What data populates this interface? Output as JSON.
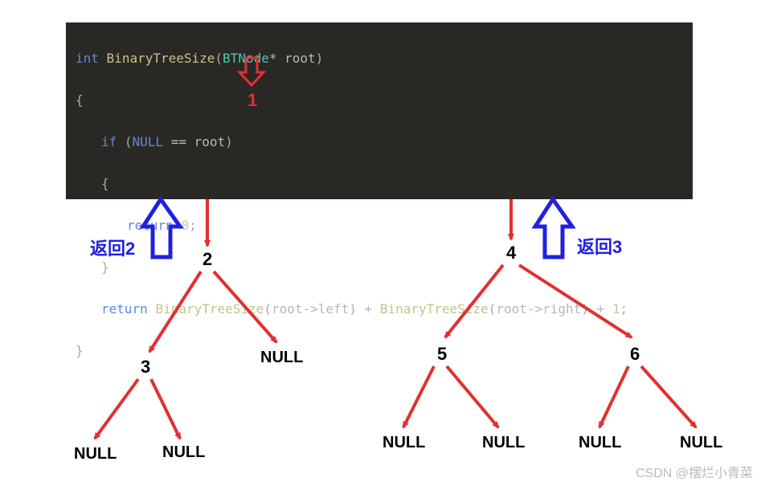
{
  "code": {
    "sig_int": "int",
    "sig_fn": "BinaryTreeSize",
    "sig_paren_open": "(",
    "sig_type": "BTNode",
    "sig_star": "*",
    "sig_param": "root",
    "sig_paren_close": ")",
    "brace_open": "{",
    "if_kw": "if",
    "if_open": " (",
    "null_kw": "NULL",
    "eq": " == ",
    "root_var": "root",
    "if_close": ")",
    "brace_open2": "{",
    "return_kw": "return",
    "zero_sp": " ",
    "zero": "0",
    "semi": ";",
    "brace_close2": "}",
    "ret2": "return",
    "fn2": "BinaryTreeSize",
    "p2o": "(",
    "root2": "root",
    "arrow": "->",
    "left": "left",
    "p2c": ")",
    "plus": " + ",
    "fn3": "BinaryTreeSize",
    "p3o": "(",
    "root3": "root",
    "arrow2": "->",
    "right": "right",
    "p3c": ")",
    "plus2": " + ",
    "one": "1",
    "semi2": ";",
    "brace_close": "}"
  },
  "labels": {
    "root_num": "1",
    "return_left": "返回2",
    "return_right": "返回3"
  },
  "tree": {
    "n2": "2",
    "n3": "3",
    "n4": "4",
    "n5": "5",
    "n6": "6",
    "null": "NULL"
  },
  "watermark": "CSDN @摆烂小青菜"
}
